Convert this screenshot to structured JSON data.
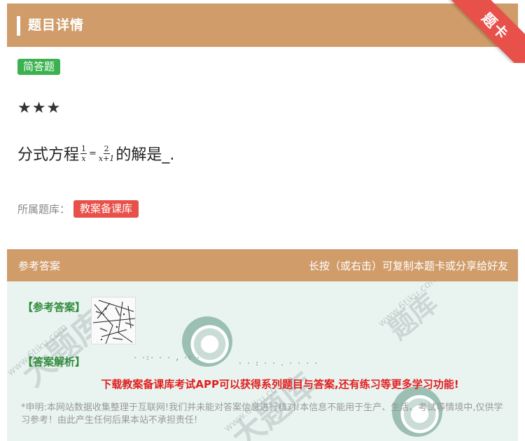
{
  "header": {
    "title": "题目详情"
  },
  "ribbon": {
    "text": "题卡"
  },
  "question": {
    "type_tag": "简答题",
    "stars": "★★★",
    "prefix": "分式方程",
    "frac1": {
      "num": "1",
      "den": "x"
    },
    "equals": "=",
    "frac2": {
      "num": "2",
      "den": "x+1"
    },
    "suffix": "的解是_."
  },
  "bank": {
    "label": "所属题库：",
    "tag": "教案备课库"
  },
  "answer_section": {
    "left_title": "参考答案",
    "right_hint": "长按（或右击）可复制本题卡或分享给好友",
    "answer_label": "【参考答案】",
    "explanation_label": "【答案解析】",
    "promo": "下载教案备课库考试APP可以获得系列题目与答案,还有练习等更多学习功能!",
    "disclaimer": "*申明:本网站数据收集整理于互联网!我们并未能对答案信息进行核对!本信息不能用于生产、生活、考试等情境中,仅供学习参考！由此产生任何后果本站不承担责任!"
  },
  "colors": {
    "header": "#d09c6a",
    "green_tag": "#3bb14f",
    "red_tag": "#e8504a",
    "answer_bg": "#e9f4f1"
  }
}
